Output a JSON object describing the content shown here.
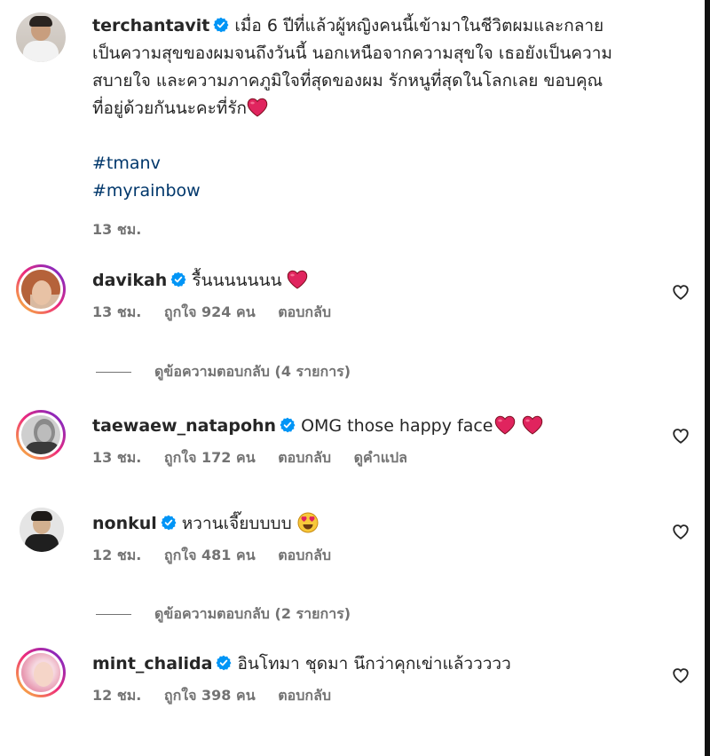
{
  "caption": {
    "username": "terchantavit",
    "text_lines": [
      "เมื่อ 6 ปีที่แล้วผู้หญิงคนนี้เข้ามาในชีวิตผมและกลาย",
      "เป็นความสุขของผมจนถึงวันนี้ นอกเหนือจากความสุขใจ เธอยังเป็นความ",
      "สบายใจ และความภาคภูมิใจที่สุดของผม รักหนูที่สุดในโลกเลย ขอบคุณ",
      "ที่อยู่ด้วยกันนะคะที่รัก"
    ],
    "hashtags": [
      "#tmanv",
      "#myrainbow"
    ],
    "time": "13 ชม."
  },
  "comments": [
    {
      "username": "davikah",
      "text": "รื้นนนนนนน",
      "time": "13 ชม.",
      "likes": "ถูกใจ 924 คน",
      "reply": "ตอบกลับ",
      "view_replies": "ดูข้อความตอบกลับ (4 รายการ)"
    },
    {
      "username": "taewaew_natapohn",
      "text": "OMG those happy face",
      "time": "13 ชม.",
      "likes": "ถูกใจ 172 คน",
      "reply": "ตอบกลับ",
      "translate": "ดูคำแปล"
    },
    {
      "username": "nonkul",
      "text": "หวานเจี๊ยบบบบ",
      "time": "12 ชม.",
      "likes": "ถูกใจ 481 คน",
      "reply": "ตอบกลับ",
      "view_replies": "ดูข้อความตอบกลับ (2 รายการ)"
    },
    {
      "username": "mint_chalida",
      "text": "อินโทมา ชุดมา นึกว่าคุกเข่าแล้ววววว",
      "time": "12 ชม.",
      "likes": "ถูกใจ 398 คน",
      "reply": "ตอบกลับ"
    }
  ],
  "colors": {
    "verified": "#0095f6",
    "hashtag": "#00376b",
    "emoji_heart": "#e0245e",
    "meta_gray": "#737373"
  },
  "icons": [
    "verified-badge-icon",
    "like-heart-icon",
    "red-heart-emoji-icon",
    "heart-eyes-emoji-icon"
  ]
}
